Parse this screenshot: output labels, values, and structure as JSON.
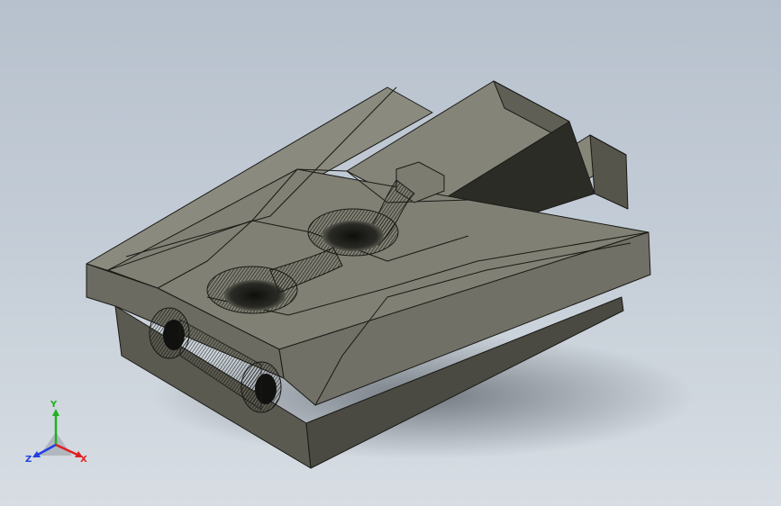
{
  "viewport": {
    "background_top": "#b7c1cd",
    "background_bottom": "#d7dde3"
  },
  "model": {
    "face_color_light": "#85857a",
    "face_color_mid": "#76766c",
    "face_color_dark": "#4f4f47",
    "edge_color": "#1a1a16"
  },
  "triad": {
    "x_label": "X",
    "y_label": "Y",
    "z_label": "Z",
    "x_color": "#e02020",
    "y_color": "#20b020",
    "z_color": "#2040e0"
  }
}
